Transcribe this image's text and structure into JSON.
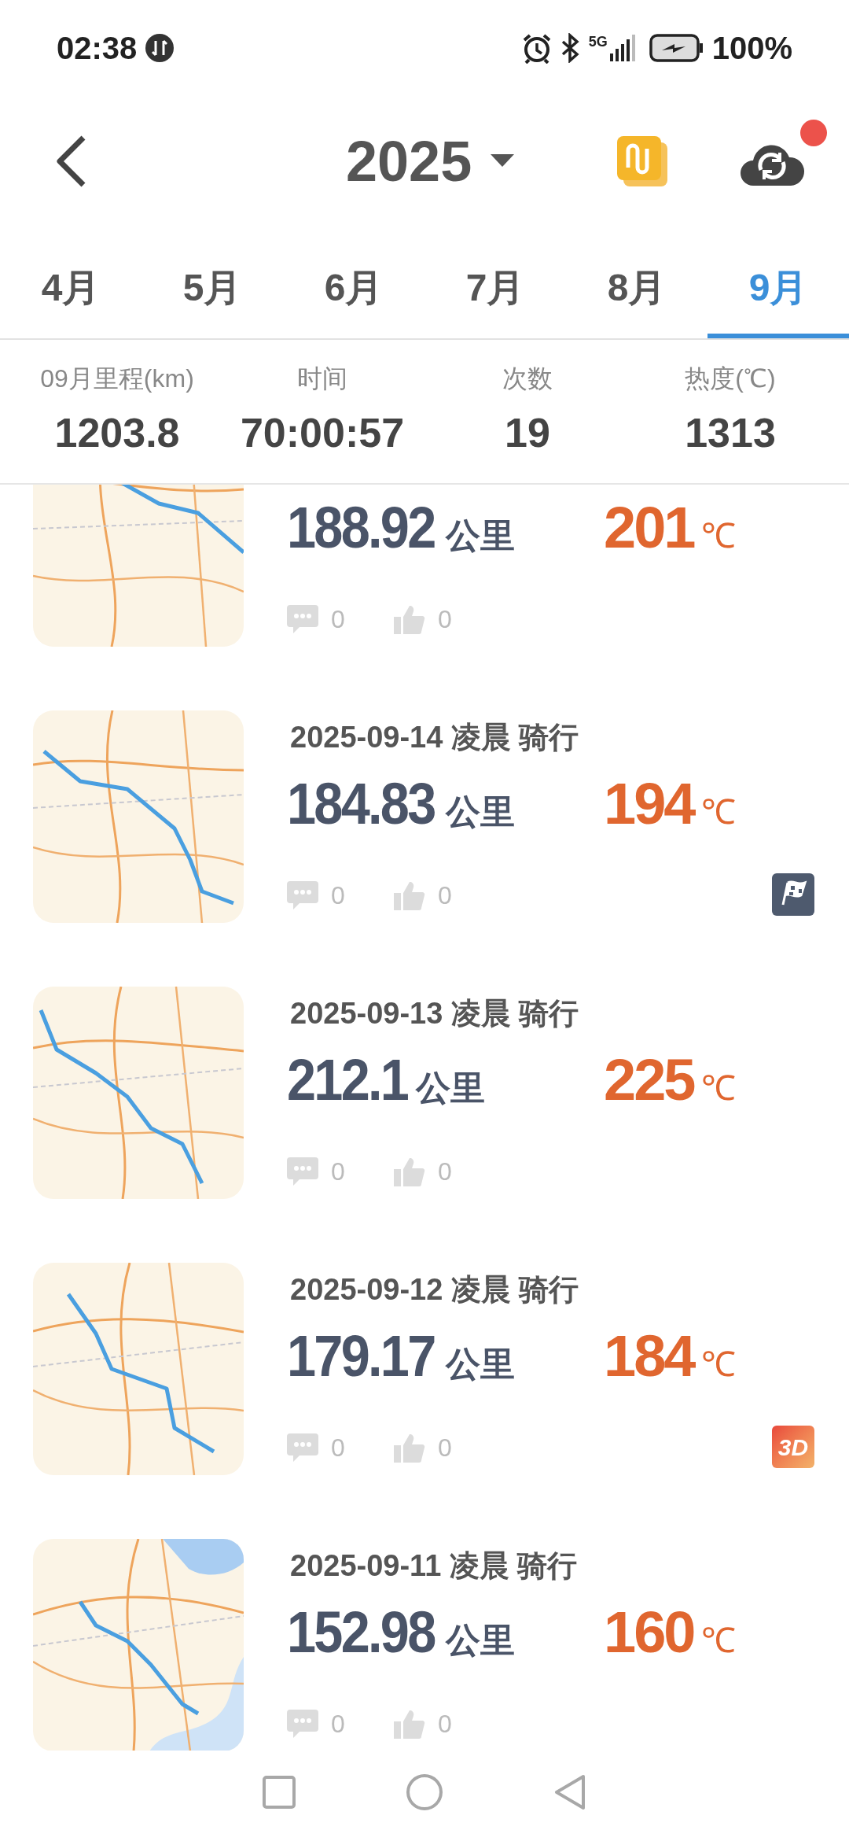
{
  "status_bar": {
    "time": "02:38",
    "network": "5G",
    "battery": "100%"
  },
  "header": {
    "year": "2025",
    "notification": true
  },
  "tabs": [
    {
      "label": "4月",
      "selected": false
    },
    {
      "label": "5月",
      "selected": false
    },
    {
      "label": "6月",
      "selected": false
    },
    {
      "label": "7月",
      "selected": false
    },
    {
      "label": "8月",
      "selected": false
    },
    {
      "label": "9月",
      "selected": true
    }
  ],
  "stats": [
    {
      "label": "09月里程(km)",
      "value": "1203.8"
    },
    {
      "label": "时间",
      "value": "70:00:57"
    },
    {
      "label": "次数",
      "value": "19"
    },
    {
      "label": "热度(℃)",
      "value": "1313"
    }
  ],
  "rides": [
    {
      "distance": "188.92",
      "unit": "公里",
      "heat": "201",
      "heat_unit": "℃",
      "comments": "0",
      "likes": "0"
    },
    {
      "date": "2025-09-14 凌晨 骑行",
      "distance": "184.83",
      "unit": "公里",
      "heat": "194",
      "heat_unit": "℃",
      "comments": "0",
      "likes": "0",
      "badge": {
        "kind": "flag"
      }
    },
    {
      "date": "2025-09-13 凌晨 骑行",
      "distance": "212.1",
      "unit": "公里",
      "heat": "225",
      "heat_unit": "℃",
      "comments": "0",
      "likes": "0"
    },
    {
      "date": "2025-09-12 凌晨 骑行",
      "distance": "179.17",
      "unit": "公里",
      "heat": "184",
      "heat_unit": "℃",
      "comments": "0",
      "likes": "0",
      "badge": {
        "kind": "text",
        "label": "3D"
      }
    },
    {
      "date": "2025-09-11 凌晨 骑行",
      "distance": "152.98",
      "unit": "公里",
      "heat": "160",
      "heat_unit": "℃",
      "comments": "0",
      "likes": "0"
    }
  ]
}
